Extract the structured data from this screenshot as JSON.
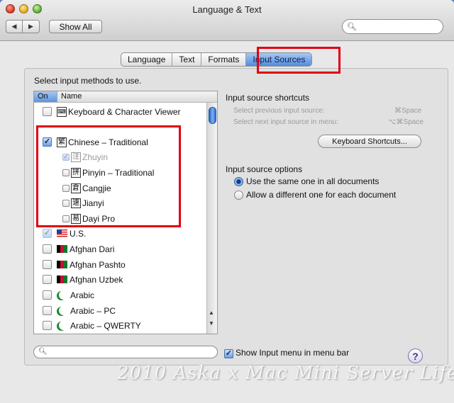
{
  "window": {
    "title": "Language & Text"
  },
  "toolbar": {
    "back_icon": "◀",
    "forward_icon": "▶",
    "show_all_label": "Show All",
    "search_placeholder": ""
  },
  "tabs": [
    {
      "label": "Language",
      "active": false
    },
    {
      "label": "Text",
      "active": false
    },
    {
      "label": "Formats",
      "active": false
    },
    {
      "label": "Input Sources",
      "active": true
    }
  ],
  "input_methods": {
    "prompt": "Select input methods to use.",
    "columns": {
      "on": "On",
      "name": "Name"
    },
    "items": [
      {
        "name": "Keyboard & Character Viewer",
        "checked": false
      },
      {
        "name": "Chinese – Traditional",
        "checked": true,
        "glyph": "繁"
      },
      {
        "name": "Zhuyin",
        "checked": true,
        "dimmed": true,
        "glyph": "注"
      },
      {
        "name": "Pinyin – Traditional",
        "checked": false,
        "glyph": "拼"
      },
      {
        "name": "Cangjie",
        "checked": false,
        "glyph": "倉"
      },
      {
        "name": "Jianyi",
        "checked": false,
        "glyph": "速"
      },
      {
        "name": "Dayi Pro",
        "checked": false,
        "glyph": "易"
      },
      {
        "name": "U.S.",
        "checked": true,
        "dimmed": true
      },
      {
        "name": "Afghan Dari",
        "checked": false
      },
      {
        "name": "Afghan Pashto",
        "checked": false
      },
      {
        "name": "Afghan Uzbek",
        "checked": false
      },
      {
        "name": "Arabic",
        "checked": false
      },
      {
        "name": "Arabic – PC",
        "checked": false
      },
      {
        "name": "Arabic – QWERTY",
        "checked": false
      }
    ]
  },
  "shortcuts": {
    "heading": "Input source shortcuts",
    "previous_label": "Select previous input source:",
    "previous_key": "⌘Space",
    "next_label": "Select next input source in menu:",
    "next_key": "⌥⌘Space",
    "button_label": "Keyboard Shortcuts..."
  },
  "options": {
    "heading": "Input source options",
    "same_label": "Use the same one in all documents",
    "different_label": "Allow a different one for each document",
    "selected": "same"
  },
  "bottom": {
    "show_menu_label": "Show Input menu in menu bar",
    "show_menu_checked": true,
    "help_label": "?"
  },
  "watermark": "2010 Aska x Mac Mini Server  Life",
  "colors": {
    "highlight": "#e00010",
    "accent": "#4f8de0"
  }
}
